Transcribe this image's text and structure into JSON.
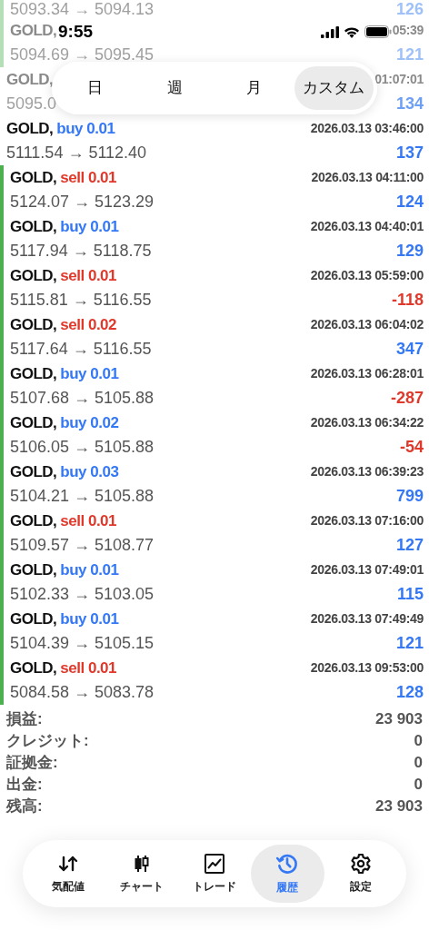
{
  "status_bar": {
    "time": "9:55"
  },
  "period_tabs": [
    {
      "label": "日",
      "selected": false
    },
    {
      "label": "週",
      "selected": false
    },
    {
      "label": "月",
      "selected": false
    },
    {
      "label": "カスタム",
      "selected": true
    }
  ],
  "trades": [
    {
      "marked": true,
      "faded": true,
      "prices": "5093.34 → 5094.13",
      "profit": {
        "text": "126",
        "color": "#9fc1fa"
      }
    },
    {
      "marked": true,
      "faded": true,
      "symbol": "GOLD,",
      "time": "05:39",
      "prices": "5094.69 → 5095.45",
      "profit": {
        "text": "121",
        "color": "#9fc1fa"
      }
    },
    {
      "marked": false,
      "faded": true,
      "symbol": "GOLD,",
      "time": "01:07:01",
      "prices": "5095.0",
      "profit": {
        "text": "134",
        "color": "#6d9ff5"
      }
    },
    {
      "marked": false,
      "faded": false,
      "symbol": "GOLD,",
      "side": {
        "text": "buy 0.01",
        "color": "#3478f6"
      },
      "time": "2026.03.13 03:46:00",
      "prices": "5111.54 → 5112.40",
      "profit": {
        "text": "137",
        "color": "#3478f6"
      }
    },
    {
      "marked": true,
      "faded": false,
      "symbol": "GOLD,",
      "side": {
        "text": "sell 0.01",
        "color": "#e0392b"
      },
      "time": "2026.03.13 04:11:00",
      "prices": "5124.07 → 5123.29",
      "profit": {
        "text": "124",
        "color": "#3478f6"
      }
    },
    {
      "marked": true,
      "faded": false,
      "symbol": "GOLD,",
      "side": {
        "text": "buy 0.01",
        "color": "#3478f6"
      },
      "time": "2026.03.13 04:40:01",
      "prices": "5117.94 → 5118.75",
      "profit": {
        "text": "129",
        "color": "#3478f6"
      }
    },
    {
      "marked": true,
      "faded": false,
      "symbol": "GOLD,",
      "side": {
        "text": "sell 0.01",
        "color": "#e0392b"
      },
      "time": "2026.03.13 05:59:00",
      "prices": "5115.81 → 5116.55",
      "profit": {
        "text": "-118",
        "color": "#e0392b"
      }
    },
    {
      "marked": true,
      "faded": false,
      "symbol": "GOLD,",
      "side": {
        "text": "sell 0.02",
        "color": "#e0392b"
      },
      "time": "2026.03.13 06:04:02",
      "prices": "5117.64 → 5116.55",
      "profit": {
        "text": "347",
        "color": "#3478f6"
      }
    },
    {
      "marked": true,
      "faded": false,
      "symbol": "GOLD,",
      "side": {
        "text": "buy 0.01",
        "color": "#3478f6"
      },
      "time": "2026.03.13 06:28:01",
      "prices": "5107.68 → 5105.88",
      "profit": {
        "text": "-287",
        "color": "#e0392b"
      }
    },
    {
      "marked": true,
      "faded": false,
      "symbol": "GOLD,",
      "side": {
        "text": "buy 0.02",
        "color": "#3478f6"
      },
      "time": "2026.03.13 06:34:22",
      "prices": "5106.05 → 5105.88",
      "profit": {
        "text": "-54",
        "color": "#e0392b"
      }
    },
    {
      "marked": true,
      "faded": false,
      "symbol": "GOLD,",
      "side": {
        "text": "buy 0.03",
        "color": "#3478f6"
      },
      "time": "2026.03.13 06:39:23",
      "prices": "5104.21 → 5105.88",
      "profit": {
        "text": "799",
        "color": "#3478f6"
      }
    },
    {
      "marked": true,
      "faded": false,
      "symbol": "GOLD,",
      "side": {
        "text": "sell 0.01",
        "color": "#e0392b"
      },
      "time": "2026.03.13 07:16:00",
      "prices": "5109.57 → 5108.77",
      "profit": {
        "text": "127",
        "color": "#3478f6"
      }
    },
    {
      "marked": true,
      "faded": false,
      "symbol": "GOLD,",
      "side": {
        "text": "buy 0.01",
        "color": "#3478f6"
      },
      "time": "2026.03.13 07:49:01",
      "prices": "5102.33 → 5103.05",
      "profit": {
        "text": "115",
        "color": "#3478f6"
      }
    },
    {
      "marked": true,
      "faded": false,
      "symbol": "GOLD,",
      "side": {
        "text": "buy 0.01",
        "color": "#3478f6"
      },
      "time": "2026.03.13 07:49:49",
      "prices": "5104.39 → 5105.15",
      "profit": {
        "text": "121",
        "color": "#3478f6"
      }
    },
    {
      "marked": true,
      "faded": false,
      "symbol": "GOLD,",
      "side": {
        "text": "sell 0.01",
        "color": "#e0392b"
      },
      "time": "2026.03.13 09:53:00",
      "prices": "5084.58 → 5083.78",
      "profit": {
        "text": "128",
        "color": "#3478f6"
      }
    }
  ],
  "summary": [
    {
      "label": "損益:",
      "value": "23 903"
    },
    {
      "label": "クレジット:",
      "value": "0"
    },
    {
      "label": "証拠金:",
      "value": "0"
    },
    {
      "label": "出金:",
      "value": "0"
    },
    {
      "label": "残高:",
      "value": "23 903"
    }
  ],
  "nav": [
    {
      "kind": "quotes",
      "label": "気配値",
      "selected": false
    },
    {
      "kind": "chart",
      "label": "チャート",
      "selected": false
    },
    {
      "kind": "trade",
      "label": "トレード",
      "selected": false
    },
    {
      "kind": "history",
      "label": "履歴",
      "selected": true
    },
    {
      "kind": "settings",
      "label": "設定",
      "selected": false
    }
  ]
}
